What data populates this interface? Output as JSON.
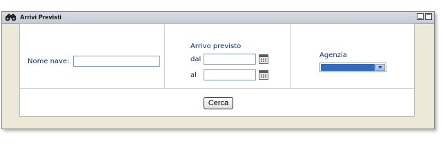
{
  "window": {
    "title": "Arrivi Previsti"
  },
  "form": {
    "nome_nave_label": "Nome nave:",
    "nome_nave_value": "",
    "arrivo_header": "Arrivo previsto",
    "dal_label": "dal",
    "dal_value": "",
    "al_label": "al",
    "al_value": "",
    "agenzia_label": "Agenzia",
    "agenzia_selected": "",
    "search_button": "Cerca"
  },
  "icons": {
    "title": "binoculars-icon",
    "calendar": "calendar-icon",
    "minimize": "minimize-icon",
    "maximize": "maximize-icon",
    "dropdown": "chevron-down-icon"
  },
  "colors": {
    "label": "#0f2d73",
    "select_highlight": "#316ac5",
    "window_bg": "#ece9d8"
  }
}
